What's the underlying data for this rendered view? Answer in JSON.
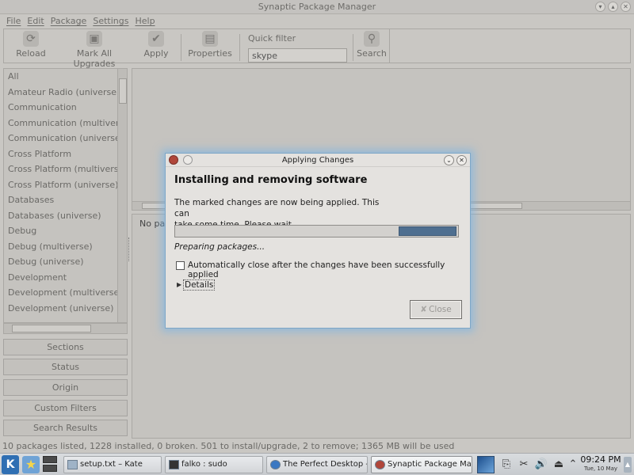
{
  "window": {
    "title": "Synaptic Package Manager"
  },
  "menu": [
    "File",
    "Edit",
    "Package",
    "Settings",
    "Help"
  ],
  "toolbar": {
    "reload": "Reload",
    "mark_all": "Mark All Upgrades",
    "apply": "Apply",
    "properties": "Properties",
    "quick_filter_label": "Quick filter",
    "quick_filter_value": "skype",
    "search": "Search"
  },
  "sections": [
    "All",
    "Amateur Radio (universe)",
    "Communication",
    "Communication (multiverse)",
    "Communication (universe)",
    "Cross Platform",
    "Cross Platform (multiverse)",
    "Cross Platform (universe)",
    "Databases",
    "Databases (universe)",
    "Debug",
    "Debug (multiverse)",
    "Debug (universe)",
    "Development",
    "Development (multiverse)",
    "Development (universe)"
  ],
  "filter_buttons": [
    "Sections",
    "Status",
    "Origin",
    "Custom Filters",
    "Search Results"
  ],
  "detail_text": "No pac",
  "statusbar": "10 packages listed, 1228 installed, 0 broken. 501 to install/upgrade, 2 to remove; 1365 MB will be used",
  "dialog": {
    "title": "Applying Changes",
    "heading": "Installing and removing software",
    "message_line1": "The marked changes are now being applied. This can",
    "message_line2": "take some time. Please wait.",
    "status": "Preparing packages...",
    "progress_fill": {
      "start": 0.795,
      "end": 1.0
    },
    "auto_close_label": "Automatically close after the changes have been successfully applied",
    "details_label": "Details",
    "close_label": "Close"
  },
  "taskbar": {
    "tasks": [
      "setup.txt – Kate",
      "falko : sudo",
      "The Perfect Desktop -",
      "Synaptic Package Mana"
    ],
    "time": "09:24 PM",
    "date": "Tue, 10 May"
  },
  "icons": {
    "kmenu": "kde-menu-icon",
    "reload": "reload-icon",
    "apply": "apply-checkmark-icon",
    "properties": "properties-icon",
    "search": "search-icon"
  }
}
